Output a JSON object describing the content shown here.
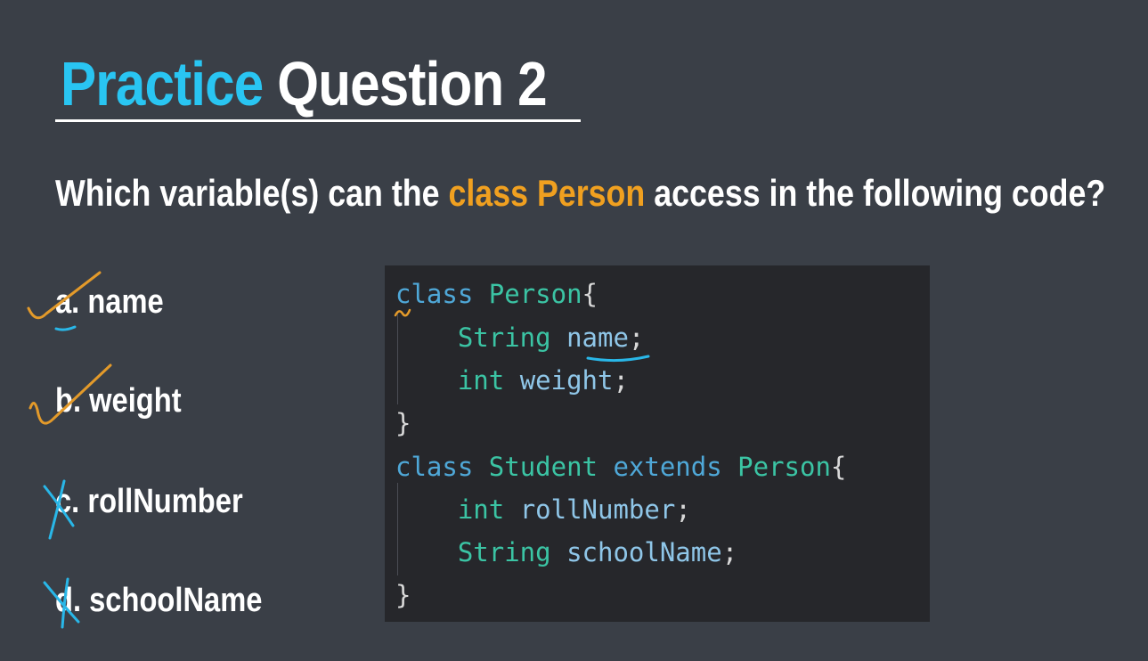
{
  "title": {
    "accent": "Practice",
    "rest": "Question 2"
  },
  "question": {
    "before": "Which variable(s) can the ",
    "highlight": "class Person",
    "after": " access in the following code?"
  },
  "options": [
    {
      "letter": "a.",
      "text": "name"
    },
    {
      "letter": "b.",
      "text": "weight"
    },
    {
      "letter": "c.",
      "text": "rollNumber"
    },
    {
      "letter": "d.",
      "text": "schoolName"
    }
  ],
  "code": {
    "l1": {
      "kw": "class",
      "name": "Person",
      "brace": "{"
    },
    "l2": {
      "type": "String",
      "id": "name",
      "semi": ";"
    },
    "l3": {
      "type": "int",
      "id": "weight",
      "semi": ";"
    },
    "l4": {
      "brace": "}"
    },
    "l5": {
      "kw": "class",
      "name": "Student",
      "kw2": "extends",
      "name2": "Person",
      "brace": "{"
    },
    "l6": {
      "type": "int",
      "id": "rollNumber",
      "semi": ";"
    },
    "l7": {
      "type": "String",
      "id": "schoolName",
      "semi": ";"
    },
    "l8": {
      "brace": "}"
    }
  },
  "colors": {
    "background": "#3a3f47",
    "title_accent": "#29c5f2",
    "question_highlight": "#f0a020",
    "check_mark": "#e39a2a",
    "cross_mark": "#29b7e8",
    "code_background": "#26272b"
  }
}
